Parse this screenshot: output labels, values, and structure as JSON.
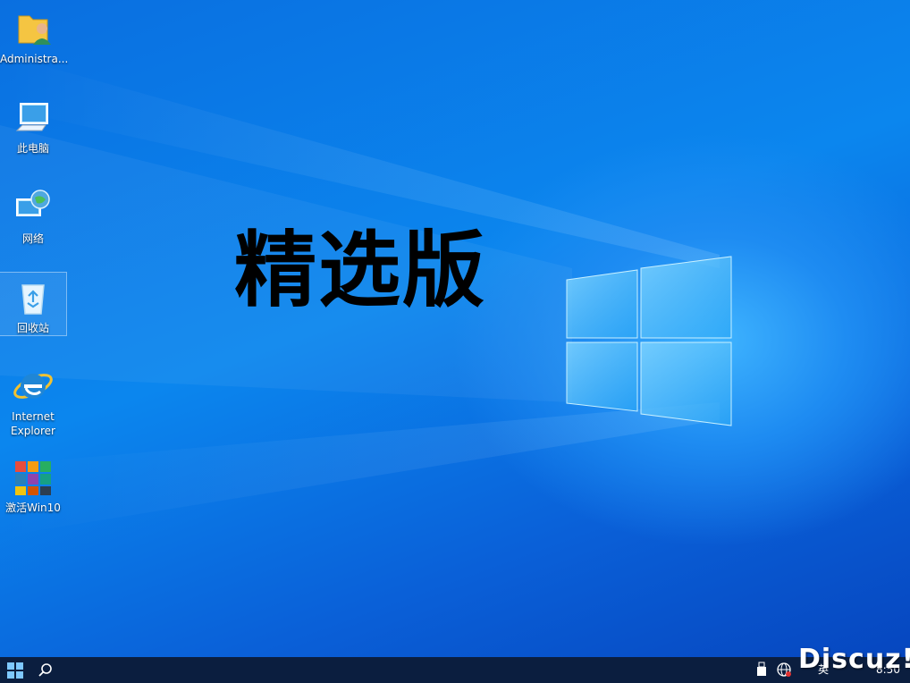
{
  "desktop": {
    "icons": [
      {
        "label": "Administra...",
        "icon": "user-folder-icon"
      },
      {
        "label": "此电脑",
        "icon": "computer-icon"
      },
      {
        "label": "网络",
        "icon": "network-icon"
      },
      {
        "label": "回收站",
        "icon": "recycle-bin-icon"
      },
      {
        "label": "Internet\nExplorer",
        "icon": "internet-explorer-icon"
      },
      {
        "label": "激活Win10",
        "icon": "activate-app-icon"
      }
    ],
    "overlay_title": "精选版"
  },
  "taskbar": {
    "start_icon": "windows-start-icon",
    "search_icon": "search-icon",
    "tray": {
      "usb_icon": "usb-device-icon",
      "network_icon": "network-globe-icon",
      "language": "英",
      "time": "8:50"
    }
  },
  "watermark": "Discuz!",
  "colors": {
    "taskbar_bg": "#0b1e3f",
    "wallpaper_blue": "#0b86ee",
    "title_text": "#000000"
  }
}
